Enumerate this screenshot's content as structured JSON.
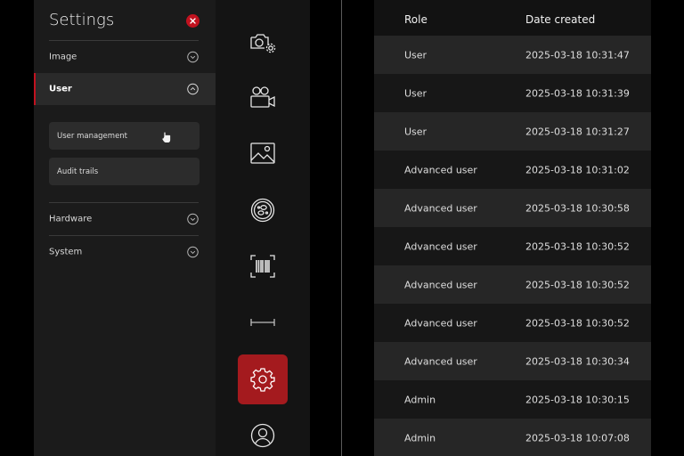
{
  "settings": {
    "title": "Settings",
    "sections": [
      {
        "label": "Image",
        "expanded": false
      },
      {
        "label": "User",
        "expanded": true,
        "items": [
          "User management",
          "Audit trails"
        ]
      },
      {
        "label": "Hardware",
        "expanded": false
      },
      {
        "label": "System",
        "expanded": false
      }
    ]
  },
  "rail": {
    "icons": [
      "camera-settings-icon",
      "video-camera-icon",
      "image-icon",
      "petri-dish-icon",
      "barcode-icon",
      "ruler-icon",
      "gear-icon",
      "user-icon"
    ],
    "active": "gear-icon"
  },
  "table": {
    "headers": {
      "role": "Role",
      "date": "Date created"
    },
    "rows": [
      {
        "role": "User",
        "date": "2025-03-18 10:31:47"
      },
      {
        "role": "User",
        "date": "2025-03-18 10:31:39"
      },
      {
        "role": "User",
        "date": "2025-03-18 10:31:27"
      },
      {
        "role": "Advanced user",
        "date": "2025-03-18 10:31:02"
      },
      {
        "role": "Advanced user",
        "date": "2025-03-18 10:30:58"
      },
      {
        "role": "Advanced user",
        "date": "2025-03-18 10:30:52"
      },
      {
        "role": "Advanced user",
        "date": "2025-03-18 10:30:52"
      },
      {
        "role": "Advanced user",
        "date": "2025-03-18 10:30:52"
      },
      {
        "role": "Advanced user",
        "date": "2025-03-18 10:30:34"
      },
      {
        "role": "Admin",
        "date": "2025-03-18 10:30:15"
      },
      {
        "role": "Admin",
        "date": "2025-03-18 10:07:08"
      }
    ]
  },
  "colors": {
    "accent": "#c1121f",
    "active_tile": "#a41a1e"
  }
}
